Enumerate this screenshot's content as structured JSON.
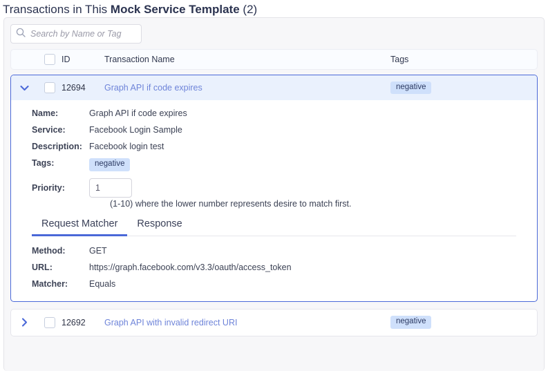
{
  "page": {
    "title_prefix": "Transactions in This ",
    "title_strong": "Mock Service Template",
    "title_count": " (2)"
  },
  "search": {
    "placeholder": "Search by Name or Tag",
    "value": "",
    "icon": "search-icon"
  },
  "table": {
    "columns": {
      "id": "ID",
      "name": "Transaction Name",
      "tags": "Tags"
    }
  },
  "rows": [
    {
      "expanded": true,
      "chevron": "chevron-down-icon",
      "checked": false,
      "id": "12694",
      "name": "Graph API if code expires",
      "tag": "negative",
      "details": {
        "labels": {
          "name": "Name:",
          "service": "Service:",
          "description": "Description:",
          "tags": "Tags:",
          "priority": "Priority:"
        },
        "name": "Graph API if code expires",
        "service": "Facebook Login Sample",
        "description": "Facebook login test",
        "tag": "negative",
        "priority": "1",
        "priority_hint": "(1-10) where the lower number represents desire to match first."
      },
      "tabs": [
        {
          "label": "Request Matcher",
          "active": true
        },
        {
          "label": "Response",
          "active": false
        }
      ],
      "request_matcher": {
        "labels": {
          "method": "Method:",
          "url": "URL:",
          "matcher": "Matcher:"
        },
        "method": "GET",
        "url": "https://graph.facebook.com/v3.3/oauth/access_token",
        "matcher": "Equals"
      }
    },
    {
      "expanded": false,
      "chevron": "chevron-right-icon",
      "checked": false,
      "id": "12692",
      "name": "Graph API with invalid redirect URI",
      "tag": "negative"
    }
  ],
  "colors": {
    "accent": "#4a68d8",
    "link": "#6e84d9",
    "badge_bg": "#cfe0fb",
    "badge_text": "#2c3a63",
    "expanded_head_bg": "#eaf1fd",
    "panel_bg": "#f7f7f9"
  }
}
